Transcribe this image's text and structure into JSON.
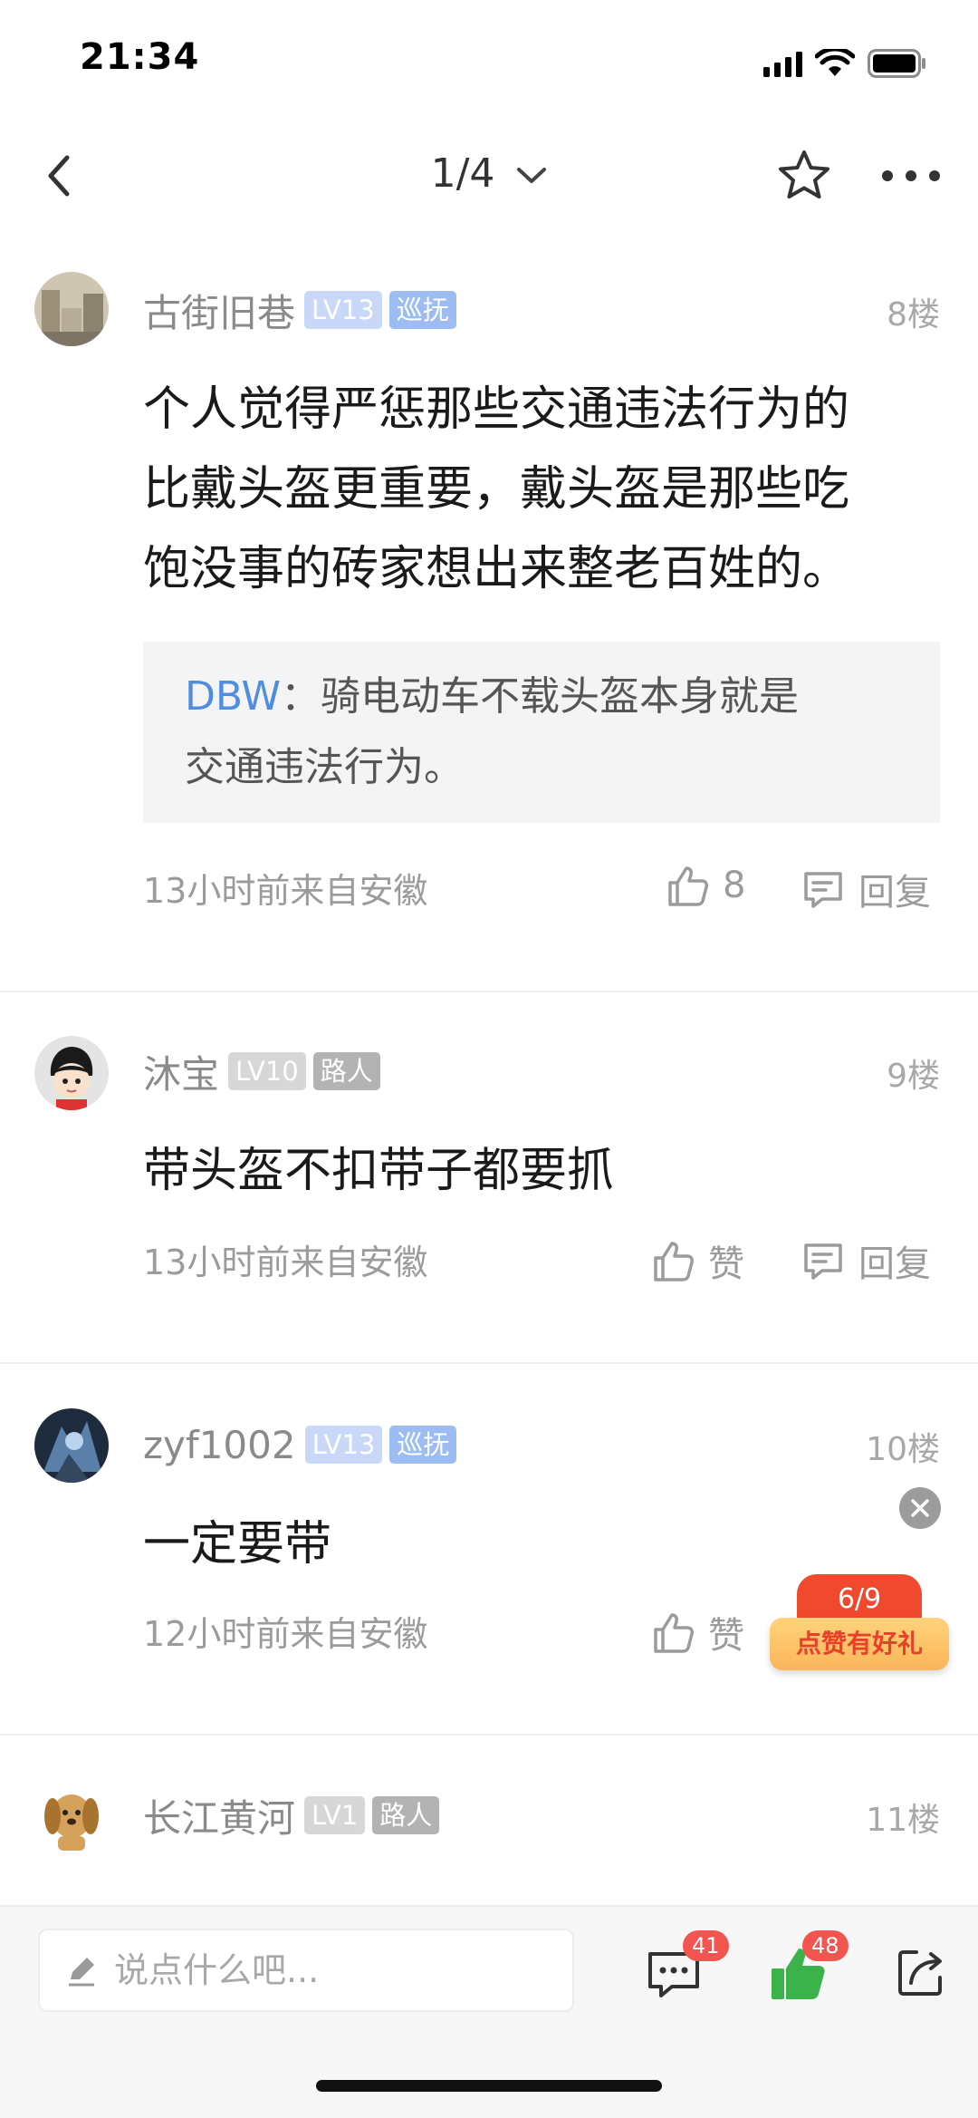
{
  "status_bar": {
    "time": "21:34"
  },
  "nav": {
    "page_indicator": "1/4"
  },
  "posts": [
    {
      "author": "古街旧巷",
      "level": "LV13",
      "title": "巡抚",
      "floor": "8楼",
      "content_lines": [
        "个人觉得严惩那些交通违法行为的",
        "比戴头盔更重要，戴头盔是那些吃",
        "饱没事的砖家想出来整老百姓的。"
      ],
      "quote": {
        "author": "DBW",
        "separator": "：",
        "line1": "骑电动车不载头盔本身就是",
        "line2": "交通违法行为。"
      },
      "meta": "13小时前来自安徽",
      "like_label": "8",
      "reply_label": "回复"
    },
    {
      "author": "沐宝",
      "level": "LV10",
      "title": "路人",
      "floor": "9楼",
      "content": "带头盔不扣带子都要抓",
      "meta": "13小时前来自安徽",
      "like_label": "赞",
      "reply_label": "回复"
    },
    {
      "author": "zyf1002",
      "level": "LV13",
      "title": "巡抚",
      "floor": "10楼",
      "content": "一定要带",
      "meta": "12小时前来自安徽",
      "like_label": "赞"
    },
    {
      "author": "长江黄河",
      "level": "LV1",
      "title": "路人",
      "floor": "11楼"
    }
  ],
  "promo": {
    "progress": "6/9",
    "label": "点赞有好礼"
  },
  "bottom_bar": {
    "input_placeholder": "说点什么吧...",
    "comment_count": "41",
    "like_count": "48"
  },
  "colors": {
    "accent_blue": "#4f8ede",
    "like_green": "#3bb34a",
    "badge_red": "#f25450",
    "promo_red": "#f0492d"
  },
  "icons": [
    "back-icon",
    "chevron-down-icon",
    "star-icon",
    "more-icon",
    "thumb-up-icon",
    "comment-icon",
    "close-icon",
    "pencil-icon",
    "share-icon"
  ]
}
